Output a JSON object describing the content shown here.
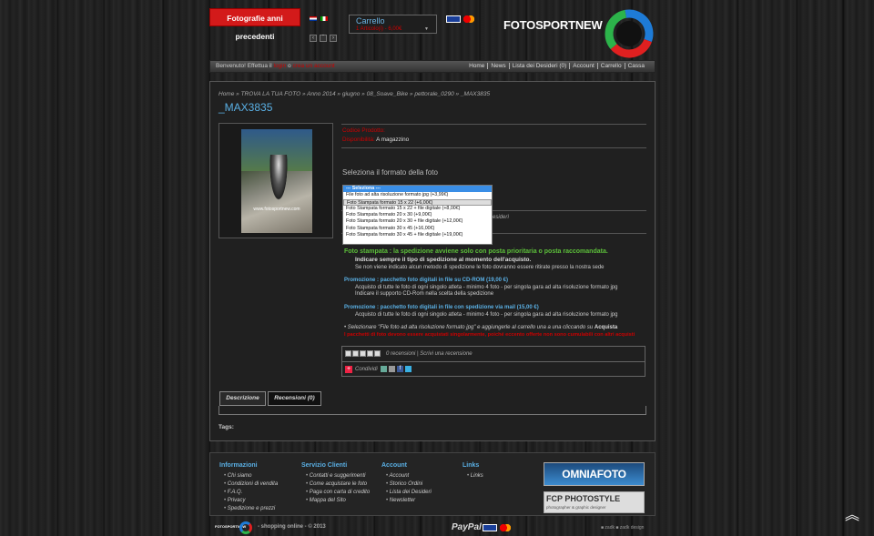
{
  "header": {
    "prev_button": "Fotografie anni precedenti",
    "cart_title": "Carrello",
    "cart_summary": "1 Articolo(i) - 6,00€",
    "logo_text": "FOTOSPORTNEW"
  },
  "topbar": {
    "welcome": "Benvenuto! Effettua il",
    "login": "login",
    "o": "o",
    "register": "crea un account",
    "links": [
      "Home",
      "News",
      "Lista dei Desideri (0)",
      "Account",
      "Carrello",
      "Cassa"
    ]
  },
  "breadcrumb": "Home » TROVA LA TUA FOTO » Anno 2014 » giugno » 08_Soave_Bike » pettorale_0290 » _MAX3835",
  "product": {
    "title": "_MAX3835",
    "watermark": "www.fotosportnew.com",
    "code_label": "Codice Prodotto:",
    "avail_label": "Disponibilità:",
    "avail_value": "A magazzino",
    "select_format": "Seleziona il formato della foto"
  },
  "options": [
    "--- Seleziona ---",
    "File foto ad alta risoluzione formato jpg (+3,99€)",
    "Foto Stampata formato 15 x 22 (+6,00€)",
    "Foto Stampata formato 15 x 22 + file digitale (+8,00€)",
    "Foto Stampata formato 20 x 30 (+9,00€)",
    "Foto Stampata formato 20 x 30 + file digitale (+12,00€)",
    "Foto Stampata formato 30 x 45 (+16,00€)",
    "Foto Stampata formato 30 x 45 + file digitale (+19,00€)"
  ],
  "wishlist_text": "esiderì",
  "info": {
    "green": "Foto stampata : la spedizione avviene solo con posta prioritaria o posta raccomandata.",
    "indicate": "Indicare sempre il tipo di spedizione al momento dell'acquisto.",
    "note": "Se non viene indicato alcun metodo di spedizione le foto dovranno essere ritirate presso la nostra sede",
    "promo1_title": "Promozione : pacchetto foto digitali in file su CD-ROM  (19,00 €)",
    "promo1_l1": "Acquisto di tutte le foto di ogni singolo atleta - minimo 4 foto - per singola gara ad alta risoluzione formato jpg",
    "promo1_l2": "Indicare il supporto CD-Rom nella scelta della spedizione",
    "promo2_title": "Promozione : pacchetto foto digitali in file con spedizione via mail  (15,00 €)",
    "promo2_l1": "Acquisto di tutte le foto di ogni singolo atleta - minimo 4 foto - per singola gara ad alta risoluzione formato jpg",
    "select_hint_a": "• Selezionare \"File foto ad alta risoluzione formato jpg\" e aggiungerle al carrello una a una cliccando su",
    "select_hint_b": "Acquista",
    "red_note": "I pacchetti di foto devono essere acquistati singolarmente, poiché eccento offerte non sono cumulabili con altri acquisti"
  },
  "reviews": {
    "count": "0 recensioni",
    "write": "Scrivi una recensione",
    "share": "Condividi"
  },
  "tabs": [
    "Descrizione",
    "Recensioni (0)"
  ],
  "tags": "Tags:",
  "footer": {
    "cols": [
      {
        "title": "Informazioni",
        "items": [
          "Chi siamo",
          "Condizioni di vendita",
          "F.A.Q.",
          "Privacy",
          "Spedizione e prezzi"
        ]
      },
      {
        "title": "Servizio Clienti",
        "items": [
          "Contatti e suggerimenti",
          "Come acquistare le foto",
          "Paga con carta di credito",
          "Mappa del Sito"
        ]
      },
      {
        "title": "Account",
        "items": [
          "Account",
          "Storico Ordini",
          "Lista dei Desideri",
          "Newsletter"
        ]
      },
      {
        "title": "Links",
        "items": [
          "Links"
        ]
      }
    ],
    "omnia": "OMNIAFOTO",
    "fcp": "FCP PHOTOSTYLE",
    "fcp_sub": "photographer & graphic designer",
    "copyright": "- shopping online - © 2013",
    "mini_logo": "FOTOSPORTNEW",
    "paypal": "PayPal",
    "credits": "■ zadk   ■ zadk design"
  },
  "colors": {
    "accent_blue": "#5ab0e5",
    "red": "#d31a1a",
    "green": "#5cbf3a"
  }
}
